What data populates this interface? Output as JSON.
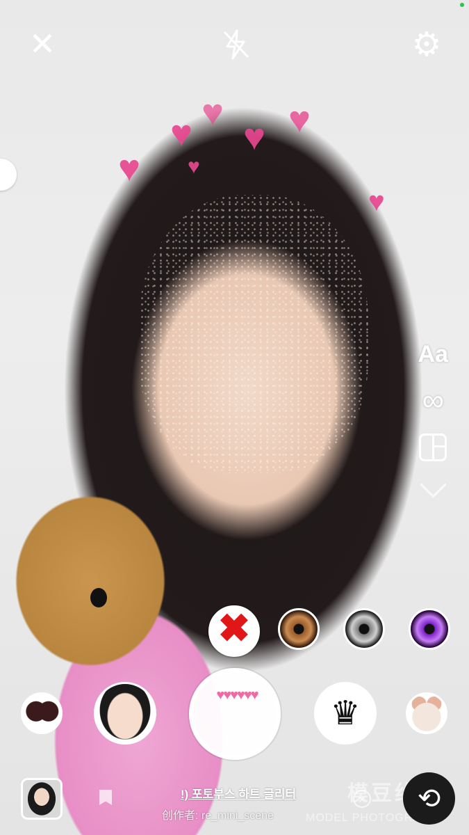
{
  "topbar": {
    "close_icon": "close-icon",
    "flash_icon": "flash-off-icon",
    "settings_icon": "gear-icon"
  },
  "tools": {
    "text_label": "Aa",
    "boomerang_symbol": "∞",
    "layout_icon": "layout-icon",
    "more_icon": "chevron-down-icon"
  },
  "lenses": {
    "none_mark": "✖",
    "colors": [
      "#9a5b2a",
      "#7b7b7b",
      "#7b21c8"
    ]
  },
  "filters": {
    "shutter_hearts": "♥♥♥♥♥♥",
    "crown_symbol": "♛"
  },
  "effect": {
    "name": "!) 포토부스 하트 글리터",
    "author": "创作者: re_mini_scene"
  },
  "watermark": {
    "cn": "模豆约拍",
    "en": "MODEL PHOTOGRAPH"
  },
  "bottom": {
    "dismiss_symbol": "×",
    "flip_symbol": "⟲"
  }
}
